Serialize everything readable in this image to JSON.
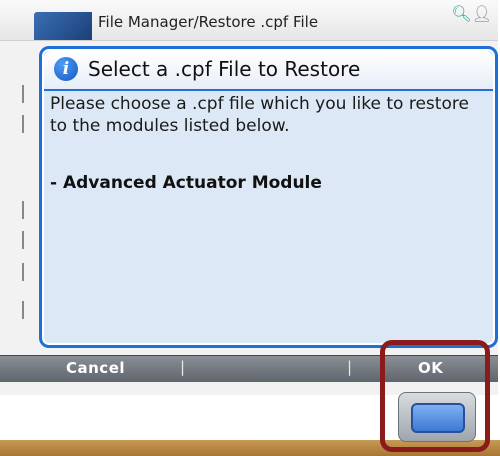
{
  "window": {
    "title": "File Manager/Restore .cpf File"
  },
  "dialog": {
    "title": "Select a .cpf File to Restore",
    "message": "Please choose a .cpf file which you like to restore to the modules listed below.",
    "module_item": "- Advanced Actuator Module"
  },
  "softkeys": {
    "left_label": "Cancel",
    "right_label": "OK",
    "separator": "|"
  },
  "icons": {
    "title_logo": "app-logo-icon",
    "status_search": "search-icon",
    "status_user": "user-icon",
    "info": "info-icon",
    "hardware_ok": "hardware-ok-button"
  },
  "colors": {
    "dialog_border": "#1f6fd8",
    "dialog_fill": "#dce8f5",
    "softkey_bar": "#5f656c",
    "highlight": "#8b1a1a"
  }
}
